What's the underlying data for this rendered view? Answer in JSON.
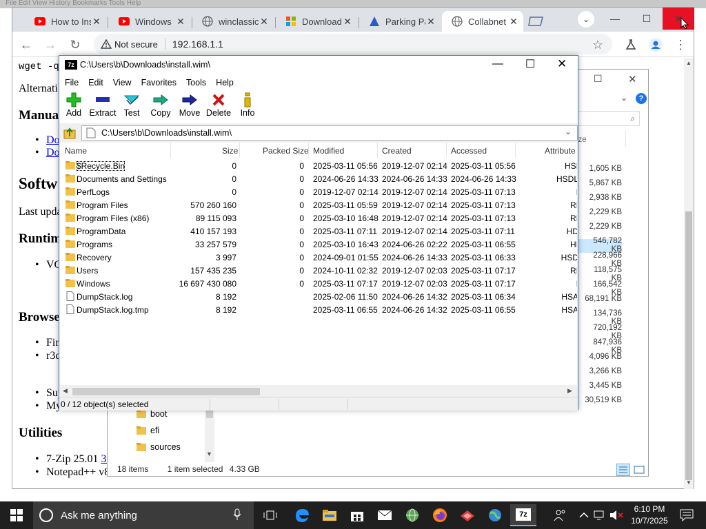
{
  "desktop_top_text": "File   Edit   View   History   Bookmarks   Tools   Help",
  "chrome": {
    "tabs": [
      {
        "title": "How to Ins",
        "icon": "youtube-icon"
      },
      {
        "title": "Windows",
        "icon": "youtube-icon"
      },
      {
        "title": "winclassic",
        "icon": "globe-icon"
      },
      {
        "title": "Download",
        "icon": "windows-logo-icon"
      },
      {
        "title": "Parking Pa",
        "icon": "triangle-logo-icon"
      },
      {
        "title": "Collabnet",
        "icon": "globe-icon",
        "active": true
      }
    ],
    "address": {
      "security": "Not secure",
      "url": "192.168.1.1"
    }
  },
  "page": {
    "wget_line": "wget -qO",
    "alt_text": "Alternati",
    "manual_heading": "Manua",
    "links": [
      "Do",
      "Do"
    ],
    "software_heading": "Softw",
    "last_updated": "Last upda",
    "runtime_heading": "Runtim",
    "runtime_item": "VC",
    "browser_heading": "Browse",
    "browser_items": [
      "Fir",
      "r3d"
    ],
    "browser_items2": [
      "Sup",
      "My"
    ],
    "utilities_heading": "Utilities",
    "utilities_items": [
      {
        "text": "7-Zip 25.01 ",
        "link": "32"
      },
      {
        "text": "Notepad++ v8",
        "link": ""
      }
    ]
  },
  "explorer": {
    "folders": [
      "boot",
      "efi",
      "sources"
    ],
    "status_items": "18 items",
    "status_selected": "1 item selected",
    "status_size": "4.33 GB",
    "size_header": "ize",
    "sizes": [
      "1,605 KB",
      "5,867 KB",
      "2,938 KB",
      "2,229 KB",
      "2,229 KB",
      "546,782 KB",
      "228,966 KB",
      "118,575 KB",
      "166,542 KB",
      "68,191 KB",
      "134,736 KB",
      "720,192 KB",
      "847,936 KB",
      "4,096 KB",
      "3,266 KB",
      "3,445 KB",
      "30,519 KB"
    ]
  },
  "sevenzip": {
    "title": "C:\\Users\\b\\Downloads\\install.wim\\",
    "menu": [
      "File",
      "Edit",
      "View",
      "Favorites",
      "Tools",
      "Help"
    ],
    "toolbar": [
      "Add",
      "Extract",
      "Test",
      "Copy",
      "Move",
      "Delete",
      "Info"
    ],
    "path": "C:\\Users\\b\\Downloads\\install.wim\\",
    "columns": [
      "Name",
      "Size",
      "Packed Size",
      "Modified",
      "Created",
      "Accessed",
      "Attribute"
    ],
    "rows": [
      {
        "name": "$Recycle.Bin",
        "size": "0",
        "packed": "0",
        "modified": "2025-03-11 05:56",
        "created": "2019-12-07 02:14",
        "accessed": "2025-03-11 05:56",
        "attr": "HSI",
        "type": "folder"
      },
      {
        "name": "Documents and Settings",
        "size": "0",
        "packed": "0",
        "modified": "2024-06-26 14:33",
        "created": "2024-06-26 14:33",
        "accessed": "2024-06-26 14:33",
        "attr": "HSDL",
        "type": "folder"
      },
      {
        "name": "PerfLogs",
        "size": "0",
        "packed": "0",
        "modified": "2019-12-07 02:14",
        "created": "2019-12-07 02:14",
        "accessed": "2025-03-11 07:13",
        "attr": "I",
        "type": "folder"
      },
      {
        "name": "Program Files",
        "size": "570 260 160",
        "packed": "0",
        "modified": "2025-03-11 05:59",
        "created": "2019-12-07 02:14",
        "accessed": "2025-03-11 07:13",
        "attr": "RI",
        "type": "folder"
      },
      {
        "name": "Program Files (x86)",
        "size": "89 115 093",
        "packed": "0",
        "modified": "2025-03-10 16:48",
        "created": "2019-12-07 02:14",
        "accessed": "2025-03-11 07:13",
        "attr": "RI",
        "type": "folder"
      },
      {
        "name": "ProgramData",
        "size": "410 157 193",
        "packed": "0",
        "modified": "2025-03-11 07:11",
        "created": "2019-12-07 02:14",
        "accessed": "2025-03-11 07:11",
        "attr": "HD",
        "type": "folder"
      },
      {
        "name": "Programs",
        "size": "33 257 579",
        "packed": "0",
        "modified": "2025-03-10 16:43",
        "created": "2024-06-26 02:22",
        "accessed": "2025-03-11 06:55",
        "attr": "HI",
        "type": "folder"
      },
      {
        "name": "Recovery",
        "size": "3 997",
        "packed": "0",
        "modified": "2024-09-01 01:55",
        "created": "2024-06-26 14:33",
        "accessed": "2025-03-11 06:33",
        "attr": "HSD",
        "type": "folder"
      },
      {
        "name": "Users",
        "size": "157 435 235",
        "packed": "0",
        "modified": "2024-10-11 02:32",
        "created": "2019-12-07 02:03",
        "accessed": "2025-03-11 07:17",
        "attr": "RI",
        "type": "folder"
      },
      {
        "name": "Windows",
        "size": "16 697 430 080",
        "packed": "0",
        "modified": "2025-03-11 07:17",
        "created": "2019-12-07 02:03",
        "accessed": "2025-03-11 07:17",
        "attr": "I",
        "type": "folder"
      },
      {
        "name": "DumpStack.log",
        "size": "8 192",
        "packed": "",
        "modified": "2025-02-06 11:50",
        "created": "2024-06-26 14:32",
        "accessed": "2025-03-11 06:34",
        "attr": "HSA",
        "type": "file"
      },
      {
        "name": "DumpStack.log.tmp",
        "size": "8 192",
        "packed": "",
        "modified": "2025-03-11 06:55",
        "created": "2024-06-26 14:32",
        "accessed": "2025-03-11 06:55",
        "attr": "HSA",
        "type": "file"
      }
    ],
    "status": "0 / 12 object(s) selected"
  },
  "taskbar": {
    "search_placeholder": "Ask me anything",
    "time": "6:10 PM",
    "date": "10/7/2025"
  }
}
